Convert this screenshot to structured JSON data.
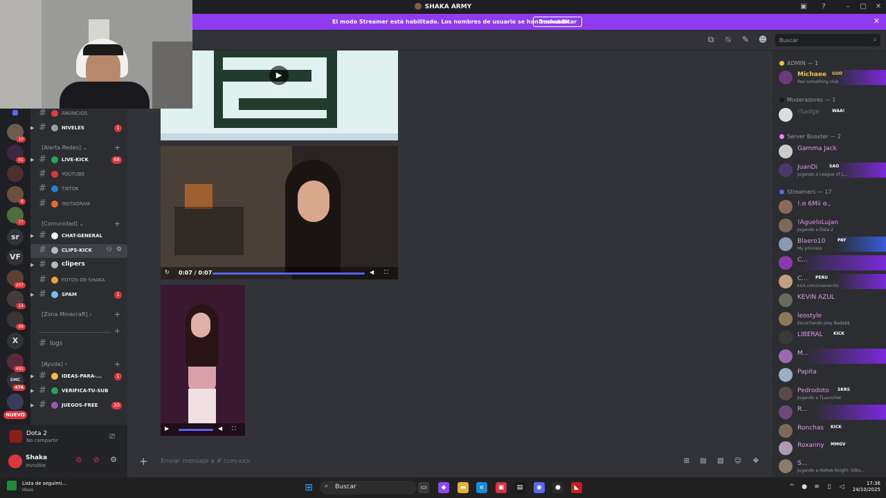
{
  "window": {
    "title": "SHAKA ARMY"
  },
  "banner": {
    "text": "El modo Streamer está habilitado. Los nombres de usuario se han truncado.",
    "button": "Deshabilitar",
    "close": "✕"
  },
  "toolbar": {
    "search_placeholder": "Buscar"
  },
  "rail": {
    "badges": [
      "10",
      "91",
      "6",
      "77",
      "207",
      "14",
      "99",
      "491",
      "476"
    ],
    "text_servers": [
      "sr",
      "VF",
      "X",
      "SMC"
    ],
    "new_label": "NUEVO"
  },
  "channels": {
    "items": [
      {
        "name": "ANUNCIOS",
        "emoji_color": "#d84040",
        "badge": ""
      },
      {
        "name": "NIVELES",
        "emoji_color": "#9aa0a6",
        "badge": "1"
      },
      {
        "name": "LIVE-KICK",
        "emoji_color": "#23a55a",
        "badge": "66"
      },
      {
        "name": "YOUTUBE",
        "emoji_color": "#da373c",
        "badge": ""
      },
      {
        "name": "TIKTOK",
        "emoji_color": "#2b7bd8",
        "badge": ""
      },
      {
        "name": "INSTAGRAM",
        "emoji_color": "#e86a2a",
        "badge": ""
      },
      {
        "name": "CHAT-GENERAL",
        "emoji_color": "#f2f3f5",
        "badge": ""
      },
      {
        "name": "CLIPS-KICK",
        "emoji_color": "#b5bac1",
        "badge": ""
      },
      {
        "name": "clipers",
        "emoji_color": "#b5bac1",
        "badge": ""
      },
      {
        "name": "FOTOS-DE-SHAKA",
        "emoji_color": "#e8a23a",
        "badge": ""
      },
      {
        "name": "SPAM",
        "emoji_color": "#7ac0e8",
        "badge": "1"
      },
      {
        "name": "logs",
        "emoji_color": "",
        "badge": ""
      },
      {
        "name": "IDEAS-PARA-...",
        "emoji_color": "#f0c040",
        "badge": "1"
      },
      {
        "name": "VERIFICA-TU-SUB",
        "emoji_color": "#23a55a",
        "badge": ""
      },
      {
        "name": "JUEGOS-FREE",
        "emoji_color": "#9b59b6",
        "badge": "30"
      }
    ],
    "categories": [
      "[Alerta Redes]",
      "[Comunidad]",
      "[Zona Minecraft]",
      "[Ayuda]"
    ]
  },
  "activity": {
    "game": "Dota 2",
    "status": "No compartir"
  },
  "user": {
    "name": "Shaka",
    "status": "Invisible"
  },
  "videos": {
    "v2_time": "0:07 / 0:07"
  },
  "composer": {
    "placeholder": "Enviar mensaje a #",
    "channel": "CLIPS-KICK"
  },
  "members": {
    "groups": [
      {
        "title": "ADMIN — 1",
        "color": "#f0c040"
      },
      {
        "title": "Moderadores — 1",
        "color": "#b5bac1"
      },
      {
        "title": "Server Booster — 2",
        "color": "#f47fff"
      },
      {
        "title": "Streamers — 17",
        "color": "#5865f2"
      }
    ],
    "list": [
      {
        "name": "Michaee",
        "color": "#f0c040",
        "tag": "GOD",
        "status": "feel something club"
      },
      {
        "name": "!Sadge",
        "color": "#6d6f78",
        "tag": "WAA!",
        "status": ""
      },
      {
        "name": "Gamma Jack",
        "color": "#e09ce8",
        "tag": "",
        "status": ""
      },
      {
        "name": "JuanDi",
        "color": "#e09ce8",
        "tag": "SAO",
        "status": "Jugando a League of L..."
      },
      {
        "name": "!.ɞ 6Mii ɞ.,",
        "color": "#e09ce8",
        "tag": "",
        "status": ""
      },
      {
        "name": "!AgueloLujan",
        "color": "#e09ce8",
        "tag": "",
        "status": "Jugando a Dota 2"
      },
      {
        "name": "Blaero10",
        "color": "#e09ce8",
        "tag": "PAY",
        "status": "My princess"
      },
      {
        "name": "C...",
        "color": "#e09ce8",
        "tag": "",
        "status": ""
      },
      {
        "name": "C...",
        "color": "#e09ce8",
        "tag": "PERU",
        "status": "kick.com/cosmecito"
      },
      {
        "name": "KEVIN AZUL",
        "color": "#e09ce8",
        "tag": "",
        "status": ""
      },
      {
        "name": "leostyle",
        "color": "#e09ce8",
        "tag": "",
        "status": "Escuchando Joey Bada$$"
      },
      {
        "name": "LIBERAL",
        "color": "#e09ce8",
        "tag": "KICK",
        "status": ""
      },
      {
        "name": "M...",
        "color": "#e09ce8",
        "tag": "",
        "status": ""
      },
      {
        "name": "Papita",
        "color": "#e09ce8",
        "tag": "",
        "status": ""
      },
      {
        "name": "Pedrodoto",
        "color": "#e09ce8",
        "tag": "SKRS",
        "status": "Jugando a TLauncher"
      },
      {
        "name": "R...",
        "color": "#e09ce8",
        "tag": "",
        "status": ""
      },
      {
        "name": "Ronchas",
        "color": "#e09ce8",
        "tag": "KICK",
        "status": ""
      },
      {
        "name": "Roxanny",
        "color": "#e09ce8",
        "tag": "MMGV",
        "status": ""
      },
      {
        "name": "S...",
        "color": "#e09ce8",
        "tag": "",
        "status": "Jugando a Hollow Knight: Silks..."
      }
    ]
  },
  "taskbar": {
    "search": "Buscar",
    "widget_title": "Lista de seguimi...",
    "widget_sub": "Ideas",
    "time": "17:36",
    "date": "24/10/2025"
  }
}
